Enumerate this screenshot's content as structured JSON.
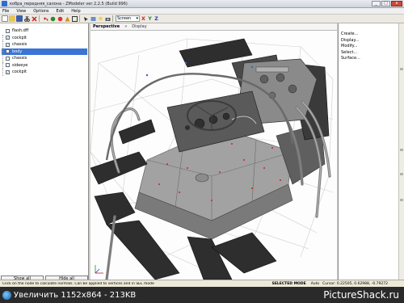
{
  "window": {
    "title": "кобра_передняя_салона - ZModeler ver 2.2.5 (Build 996)",
    "controls": {
      "minimize": "_",
      "maximize": "□",
      "close": "x"
    }
  },
  "menu": {
    "items": [
      "File",
      "View",
      "Options",
      "Edit",
      "Help"
    ]
  },
  "toolbar": {
    "icons": [
      "new-icon",
      "open-icon",
      "save-icon",
      "cut-icon",
      "delete-icon",
      "undo-icon",
      "redo-icon",
      "move-icon",
      "rotate-icon",
      "scale-icon",
      "select-icon",
      "render-icon",
      "light-icon",
      "camera-icon"
    ],
    "space_select": "Screen",
    "axes": [
      "X",
      "Y",
      "Z"
    ]
  },
  "tree": {
    "items": [
      {
        "label": "flash.dff",
        "checked": false,
        "selected": false,
        "level": 0
      },
      {
        "label": "cockpit",
        "checked": true,
        "selected": false,
        "level": 1
      },
      {
        "label": "chassis",
        "checked": true,
        "selected": false,
        "level": 1
      },
      {
        "label": "body",
        "checked": false,
        "selected": true,
        "level": 1
      },
      {
        "label": "chassis",
        "checked": false,
        "selected": false,
        "level": 1
      },
      {
        "label": "sideeye",
        "checked": false,
        "selected": false,
        "level": 1
      },
      {
        "label": "cockpit",
        "checked": true,
        "selected": false,
        "level": 1
      }
    ],
    "show_all": "Show all",
    "hide_all": "Hide all"
  },
  "viewport": {
    "tabs": [
      "Perspective",
      "Display"
    ],
    "menu_glyph": "«"
  },
  "commands": {
    "items": [
      "Create...",
      "Display...",
      "Modify...",
      "Select...",
      "Surface..."
    ]
  },
  "statusbar": {
    "message": "Click on the node to calculate normals. Can be applied to vertices and in SEL mode",
    "mode": "SELECTED MODE",
    "auto": "Auto",
    "cursor": "Cursor: 0.22505, 0.62988, -0.79272"
  },
  "watermark": {
    "left": "Увеличить 1152x864 - 213KB",
    "right": "PictureShack.ru"
  },
  "colors": {
    "selection": "#3a75d6",
    "wireframe": "#cfcfcf",
    "mesh_dark": "#2d2d2d",
    "mesh_mid": "#6e6e6e",
    "floor": "#a0a0a0",
    "vertex": "#d02020"
  }
}
